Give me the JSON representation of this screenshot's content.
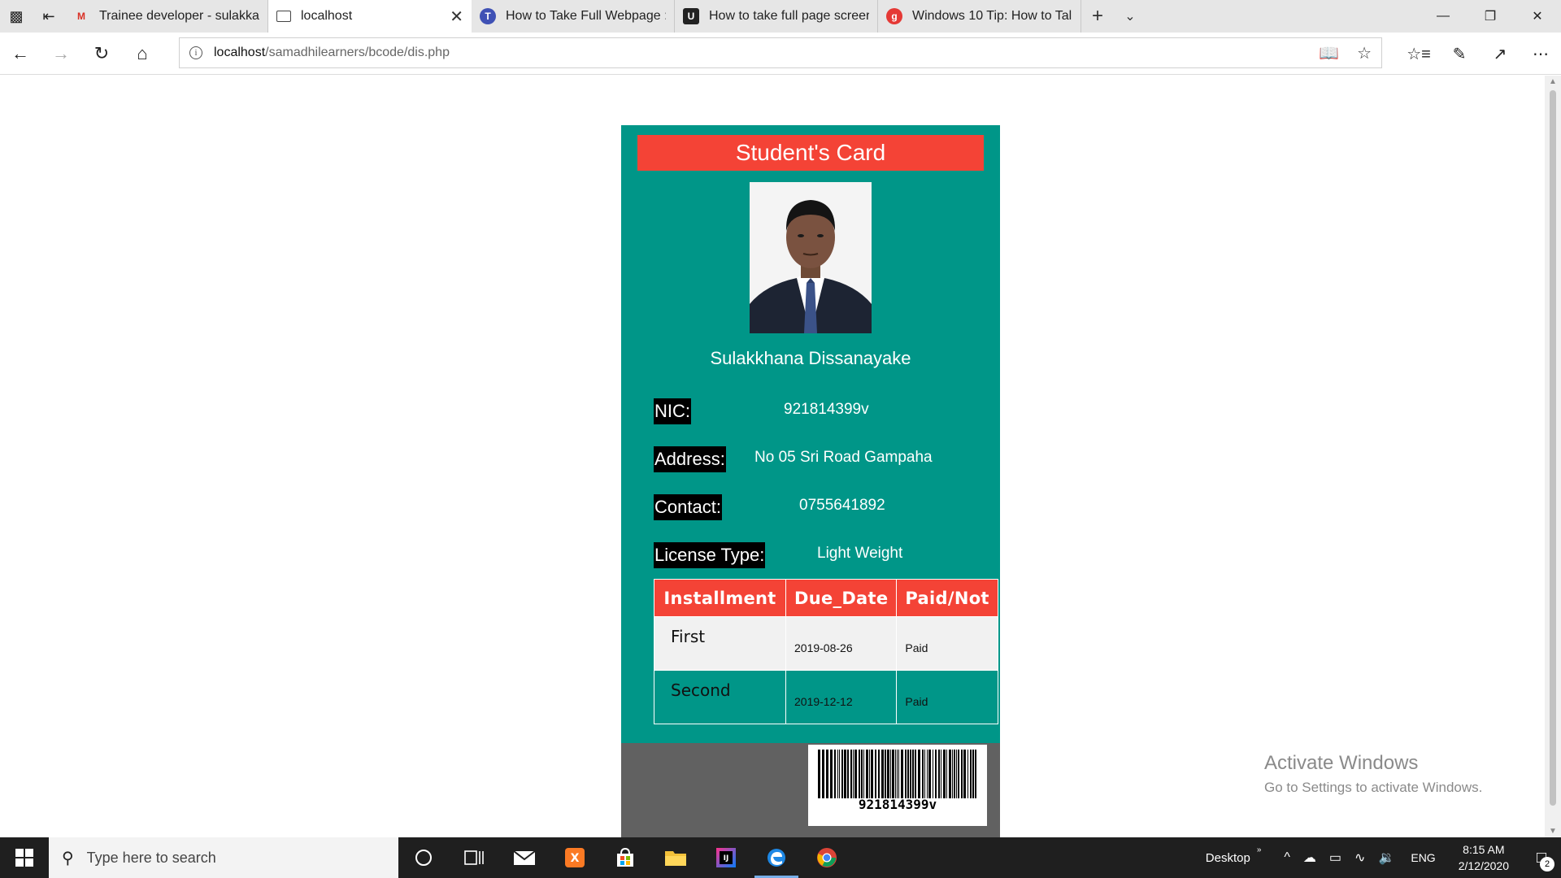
{
  "browser": {
    "tabs": [
      {
        "label": "Trainee developer - sulakkar",
        "favicon": "gmail-icon",
        "active": false
      },
      {
        "label": "localhost",
        "favicon": "page-icon",
        "active": true
      },
      {
        "label": "How to Take Full Webpage :",
        "favicon": "tt-icon",
        "active": false
      },
      {
        "label": "How to take full page screer",
        "favicon": "u-icon",
        "active": false
      },
      {
        "label": "Windows 10 Tip: How to Tal",
        "favicon": "g-icon",
        "active": false
      }
    ],
    "url_host": "localhost",
    "url_path": "/samadhilearners/bcode/dis.php"
  },
  "card": {
    "title": "Student's Card",
    "name": "Sulakkhana Dissanayake",
    "fields": [
      {
        "label": "NIC:",
        "value": "921814399v"
      },
      {
        "label": "Address:",
        "value": "No 05 Sri Road Gampaha"
      },
      {
        "label": "Contact:",
        "value": "0755641892"
      },
      {
        "label": "License Type:",
        "value": "Light Weight"
      }
    ],
    "table": {
      "headers": [
        "Installment",
        "Due_Date",
        "Paid/Not"
      ],
      "rows": [
        [
          "First",
          "2019-08-26",
          "Paid"
        ],
        [
          "Second",
          "2019-12-12",
          "Paid"
        ]
      ]
    },
    "barcode_text": "921814399v"
  },
  "watermark": {
    "title": "Activate Windows",
    "subtitle": "Go to Settings to activate Windows."
  },
  "taskbar": {
    "search_placeholder": "Type here to search",
    "desktop_label": "Desktop",
    "language": "ENG",
    "time": "8:15 AM",
    "date": "2/12/2020",
    "notification_count": "2"
  },
  "colors": {
    "card_bg": "#009688",
    "title_bar": "#f44336",
    "label_bg": "#000000",
    "card_footer": "#616161"
  }
}
